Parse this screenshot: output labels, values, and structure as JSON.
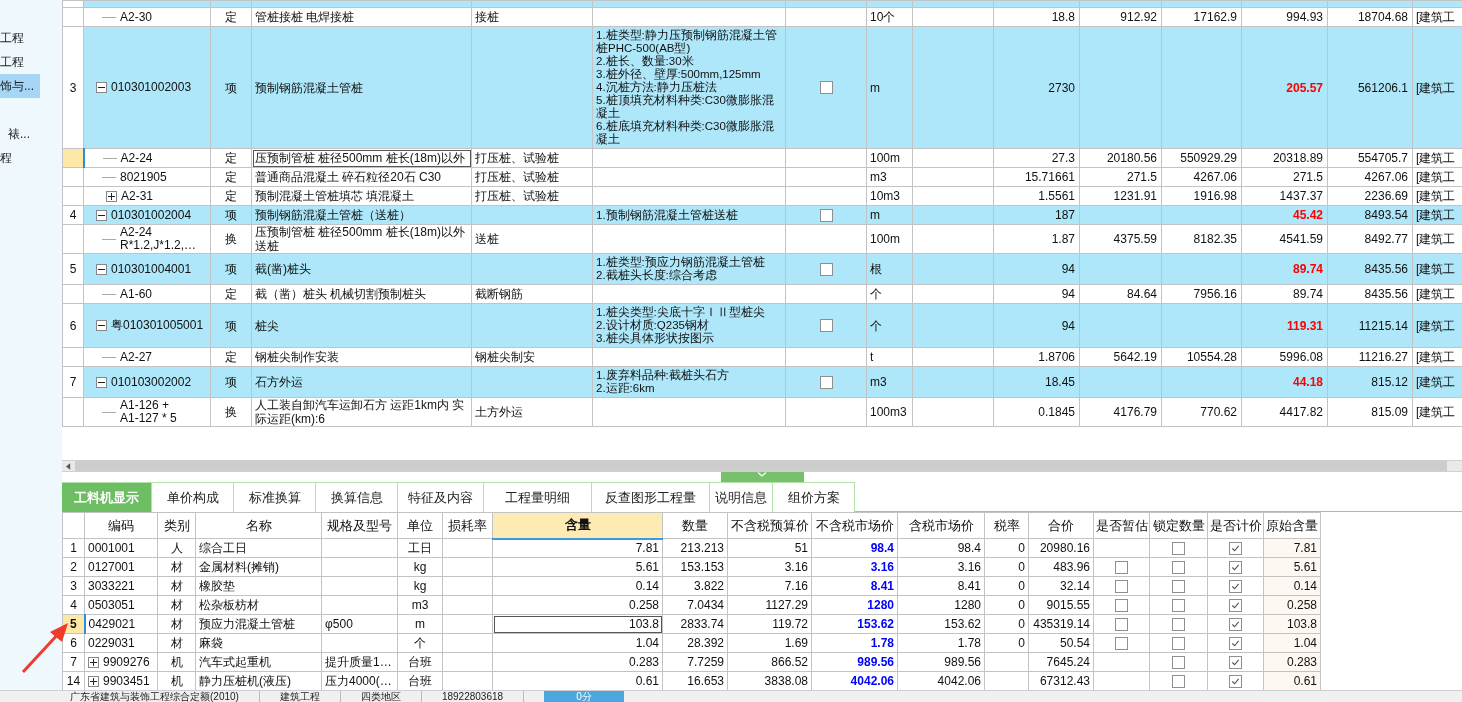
{
  "sidebar": {
    "items": [
      {
        "label": "工程",
        "selected": false
      },
      {
        "label": "工程",
        "selected": false
      },
      {
        "label": "饰与...",
        "selected": true,
        "children": [
          {
            "label": "裱...",
            "selected": false
          }
        ]
      },
      {
        "label": "程",
        "selected": false
      }
    ]
  },
  "upper_table": {
    "rows": [
      {
        "kind": "quota",
        "selected": false,
        "column_2": "A2-30",
        "column_3": "定",
        "column_4": "管桩接桩 电焊接桩",
        "column_5": "接桩",
        "column_8": "10个",
        "column_10": "18.8",
        "column_11": "912.92",
        "column_12": "17162.9",
        "column_13": "994.93",
        "column_14": "18704.68",
        "column_15": "[建筑工"
      },
      {
        "kind": "item",
        "expanded": true,
        "checked": false,
        "column_1": "3",
        "column_2": "010301002003",
        "column_3": "项",
        "column_4": "预制钢筋混凝土管桩",
        "column_6": [
          "1.桩类型:静力压预制钢筋混凝土管桩PHC-500(AB型)",
          "2.桩长、数量:30米",
          "3.桩外径、壁厚:500mm,125mm",
          "4.沉桩方法:静力压桩法",
          "5.桩顶填充材料种类:C30微膨胀混凝土",
          "6.桩底填充材料种类:C30微膨胀混凝土"
        ],
        "column_8": "m",
        "column_10": "2730",
        "column_13": "205.57",
        "column_14": "561206.1",
        "column_15": "[建筑工"
      },
      {
        "kind": "quota",
        "selected": true,
        "column_2": "A2-24",
        "column_3": "定",
        "column_4": "压预制管桩 桩径500mm 桩长(18m)以外",
        "column_5": "打压桩、试验桩",
        "column_8": "100m",
        "column_10": "27.3",
        "column_11": "20180.56",
        "column_12": "550929.29",
        "column_13": "20318.89",
        "column_14": "554705.7",
        "column_15": "[建筑工"
      },
      {
        "kind": "quota",
        "selected": false,
        "column_2": "8021905",
        "column_3": "定",
        "column_4": "普通商品混凝土 碎石粒径20石 C30",
        "column_5": "打压桩、试验桩",
        "column_8": "m3",
        "column_10": "15.71661",
        "column_11": "271.5",
        "column_12": "4267.06",
        "column_13": "271.5",
        "column_14": "4267.06",
        "column_15": "[建筑工"
      },
      {
        "kind": "quota",
        "selected": false,
        "expanded": false,
        "column_2": "A2-31",
        "column_3": "定",
        "column_4": "预制混凝土管桩填芯 填混凝土",
        "column_5": "打压桩、试验桩",
        "column_8": "10m3",
        "column_10": "1.5561",
        "column_11": "1231.91",
        "column_12": "1916.98",
        "column_13": "1437.37",
        "column_14": "2236.69",
        "column_15": "[建筑工"
      },
      {
        "kind": "item",
        "expanded": true,
        "checked": false,
        "column_1": "4",
        "column_2": "010301002004",
        "column_3": "项",
        "column_4": "预制钢筋混凝土管桩（送桩）",
        "column_6": [
          "1.预制钢筋混凝土管桩送桩"
        ],
        "column_8": "m",
        "column_10": "187",
        "column_13": "45.42",
        "column_14": "8493.54",
        "column_15": "[建筑工"
      },
      {
        "kind": "quota",
        "selected": false,
        "column_2": "A2-24\nR*1.2,J*1.2,…",
        "column_3": "换",
        "column_4": "压预制管桩 桩径500mm 桩长(18m)以外送桩",
        "column_5": "送桩",
        "column_8": "100m",
        "column_10": "1.87",
        "column_11": "4375.59",
        "column_12": "8182.35",
        "column_13": "4541.59",
        "column_14": "8492.77",
        "column_15": "[建筑工"
      },
      {
        "kind": "item",
        "expanded": true,
        "checked": false,
        "column_1": "5",
        "column_2": "010301004001",
        "column_3": "项",
        "column_4": "截(凿)桩头",
        "column_6": [
          "1.桩类型:预应力钢筋混凝土管桩",
          "2.截桩头长度:综合考虑"
        ],
        "column_8": "根",
        "column_10": "94",
        "column_13": "89.74",
        "column_14": "8435.56",
        "column_15": "[建筑工"
      },
      {
        "kind": "quota",
        "selected": false,
        "column_2": "A1-60",
        "column_3": "定",
        "column_4": "截（凿）桩头 机械切割预制桩头",
        "column_5": "截断钢筋",
        "column_8": "个",
        "column_10": "94",
        "column_11": "84.64",
        "column_12": "7956.16",
        "column_13": "89.74",
        "column_14": "8435.56",
        "column_15": "[建筑工"
      },
      {
        "kind": "item",
        "expanded": true,
        "checked": false,
        "column_1": "6",
        "column_2": "粤010301005001",
        "column_3": "项",
        "column_4": "桩尖",
        "column_6": [
          "1.桩尖类型:尖底十字ＩⅡ型桩尖",
          "2.设计材质:Q235钢材",
          "3.桩尖具体形状按图示"
        ],
        "column_8": "个",
        "column_10": "94",
        "column_13": "119.31",
        "column_14": "11215.14",
        "column_15": "[建筑工"
      },
      {
        "kind": "quota",
        "selected": false,
        "column_2": "A2-27",
        "column_3": "定",
        "column_4": "钢桩尖制作安装",
        "column_5": "钢桩尖制安",
        "column_8": "t",
        "column_10": "1.8706",
        "column_11": "5642.19",
        "column_12": "10554.28",
        "column_13": "5996.08",
        "column_14": "11216.27",
        "column_15": "[建筑工"
      },
      {
        "kind": "item",
        "expanded": true,
        "checked": false,
        "column_1": "7",
        "column_2": "010103002002",
        "column_3": "项",
        "column_4": "石方外运",
        "column_6": [
          "1.废弃料品种:截桩头石方",
          "2.运距:6km"
        ],
        "column_8": "m3",
        "column_10": "18.45",
        "column_13": "44.18",
        "column_14": "815.12",
        "column_15": "[建筑工"
      },
      {
        "kind": "quota",
        "selected": false,
        "column_2": "A1-126 +\nA1-127 * 5",
        "column_3": "换",
        "column_4": "人工装自卸汽车运卸石方 运距1km内  实际运距(km):6",
        "column_5": "土方外运",
        "column_8": "100m3",
        "column_10": "0.1845",
        "column_11": "4176.79",
        "column_12": "770.62",
        "column_13": "4417.82",
        "column_14": "815.09",
        "column_15": "[建筑工"
      }
    ]
  },
  "tabs": [
    {
      "label": "工料机显示",
      "selected": true
    },
    {
      "label": "单价构成",
      "selected": false
    },
    {
      "label": "标准换算",
      "selected": false
    },
    {
      "label": "换算信息",
      "selected": false
    },
    {
      "label": "特征及内容",
      "selected": false
    },
    {
      "label": "工程量明细",
      "selected": false
    },
    {
      "label": "反查图形工程量",
      "selected": false
    },
    {
      "label": "说明信息",
      "selected": false
    },
    {
      "label": "组价方案",
      "selected": false
    }
  ],
  "resource_table": {
    "columns": [
      {
        "label": "编码",
        "selected": false
      },
      {
        "label": "类别",
        "selected": false
      },
      {
        "label": "名称",
        "selected": false
      },
      {
        "label": "规格及型号",
        "selected": false
      },
      {
        "label": "单位",
        "selected": false
      },
      {
        "label": "损耗率",
        "selected": false
      },
      {
        "label": "含量",
        "selected": true
      },
      {
        "label": "数量",
        "selected": false
      },
      {
        "label": "不含税预算价",
        "selected": false
      },
      {
        "label": "不含税市场价",
        "selected": false
      },
      {
        "label": "含税市场价",
        "selected": false
      },
      {
        "label": "税率",
        "selected": false
      },
      {
        "label": "合价",
        "selected": false
      },
      {
        "label": "是否暂估",
        "selected": false
      },
      {
        "label": "锁定数量",
        "selected": false
      },
      {
        "label": "是否计价",
        "selected": false
      },
      {
        "label": "原始含量",
        "selected": false
      }
    ],
    "rows": [
      {
        "number": "1",
        "selected": false,
        "cells": [
          "0001001",
          "人",
          "综合工日",
          null,
          "工日",
          null,
          "7.81",
          "213.213",
          "51",
          "98.4",
          "98.4",
          "0",
          "20980.16"
        ],
        "locked": false,
        "priced": true,
        "original": "7.81"
      },
      {
        "number": "2",
        "selected": false,
        "cells": [
          "0127001",
          "材",
          "金属材料(摊销)",
          null,
          "kg",
          null,
          "5.61",
          "153.153",
          "3.16",
          "3.16",
          "3.16",
          "0",
          "483.96"
        ],
        "estimated": false,
        "locked": false,
        "priced": true,
        "original": "5.61"
      },
      {
        "number": "3",
        "selected": false,
        "cells": [
          "3033221",
          "材",
          "橡胶垫",
          null,
          "kg",
          null,
          "0.14",
          "3.822",
          "7.16",
          "8.41",
          "8.41",
          "0",
          "32.14"
        ],
        "estimated": false,
        "locked": false,
        "priced": true,
        "original": "0.14"
      },
      {
        "number": "4",
        "selected": false,
        "cells": [
          "0503051",
          "材",
          "松杂板枋材",
          null,
          "m3",
          null,
          "0.258",
          "7.0434",
          "1127.29",
          "1280",
          "1280",
          "0",
          "9015.55"
        ],
        "estimated": false,
        "locked": false,
        "priced": true,
        "original": "0.258"
      },
      {
        "number": "5",
        "selected": true,
        "cells": [
          "0429021",
          "材",
          "预应力混凝土管桩",
          "φ500",
          "m",
          null,
          "103.8",
          "2833.74",
          "119.72",
          "153.62",
          "153.62",
          "0",
          "435319.14"
        ],
        "estimated": false,
        "locked": false,
        "priced": true,
        "original": "103.8"
      },
      {
        "number": "6",
        "selected": false,
        "cells": [
          "0229031",
          "材",
          "麻袋",
          null,
          "个",
          null,
          "1.04",
          "28.392",
          "1.69",
          "1.78",
          "1.78",
          "0",
          "50.54"
        ],
        "estimated": false,
        "locked": false,
        "priced": true,
        "original": "1.04"
      },
      {
        "number": "7",
        "selected": false,
        "expanded": false,
        "cells": [
          "9909276",
          "机",
          "汽车式起重机",
          "提升质量1…",
          "台班",
          null,
          "0.283",
          "7.7259",
          "866.52",
          "989.56",
          "989.56",
          null,
          "7645.24"
        ],
        "locked": false,
        "priced": true,
        "original": "0.283"
      },
      {
        "number": "14",
        "selected": false,
        "expanded": false,
        "cells": [
          "9903451",
          "机",
          "静力压桩机(液压)",
          "压力4000(…",
          "台班",
          null,
          "0.61",
          "16.653",
          "3838.08",
          "4042.06",
          "4042.06",
          null,
          "67312.43"
        ],
        "locked": false,
        "priced": true,
        "original": "0.61"
      }
    ]
  },
  "status_bar": [
    {
      "kind": "text",
      "label": "广东省建筑与装饰工程综合定额(2010)"
    },
    {
      "kind": "text",
      "label": "建筑工程"
    },
    {
      "kind": "text",
      "label": "四类地区"
    },
    {
      "kind": "text",
      "label": "18922803618"
    },
    {
      "kind": "button",
      "label": "0分"
    }
  ]
}
